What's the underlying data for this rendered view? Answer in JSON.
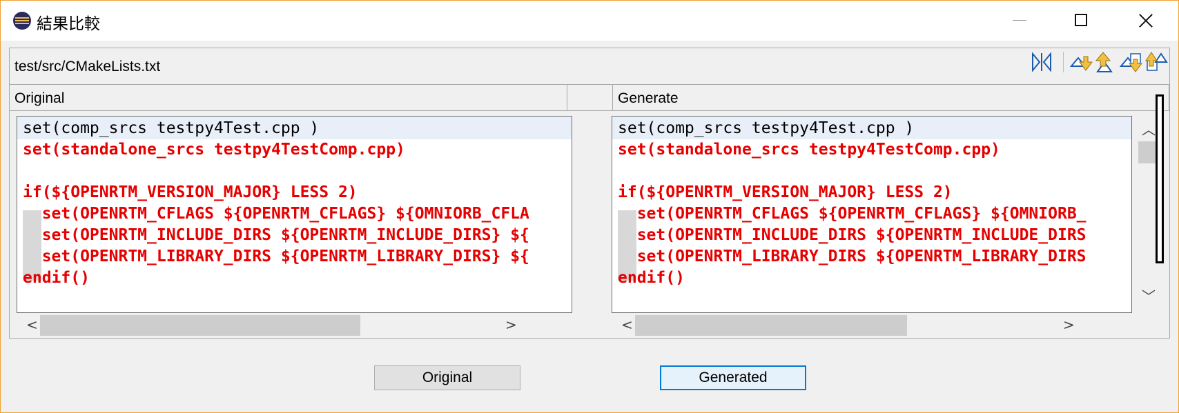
{
  "window": {
    "title": "結果比較"
  },
  "compare": {
    "file_path": "test/src/CMakeLists.txt",
    "left_label": "Original",
    "right_label": "Generate",
    "left_lines": [
      "set(comp_srcs testpy4Test.cpp )",
      "set(standalone_srcs testpy4TestComp.cpp)",
      "",
      "if(${OPENRTM_VERSION_MAJOR} LESS 2)",
      "  set(OPENRTM_CFLAGS ${OPENRTM_CFLAGS} ${OMNIORB_CFLA",
      "  set(OPENRTM_INCLUDE_DIRS ${OPENRTM_INCLUDE_DIRS} ${",
      "  set(OPENRTM_LIBRARY_DIRS ${OPENRTM_LIBRARY_DIRS} ${",
      "endif()"
    ],
    "right_lines": [
      "set(comp_srcs testpy4Test.cpp )",
      "set(standalone_srcs testpy4TestComp.cpp)",
      "",
      "if(${OPENRTM_VERSION_MAJOR} LESS 2)",
      "  set(OPENRTM_CFLAGS ${OPENRTM_CFLAGS} ${OMNIORB_",
      "  set(OPENRTM_INCLUDE_DIRS ${OPENRTM_INCLUDE_DIRS",
      "  set(OPENRTM_LIBRARY_DIRS ${OPENRTM_LIBRARY_DIRS",
      "endif()"
    ],
    "colors": {
      "diff_text": "#e60000",
      "current_line": "#e8eff8",
      "focus_border": "#0078d7"
    }
  },
  "toolbar": {
    "icons": [
      "toggle-compare-icon",
      "next-difference-icon",
      "previous-difference-icon",
      "next-change-icon",
      "previous-change-icon"
    ]
  },
  "buttons": {
    "original": "Original",
    "generated": "Generated"
  }
}
